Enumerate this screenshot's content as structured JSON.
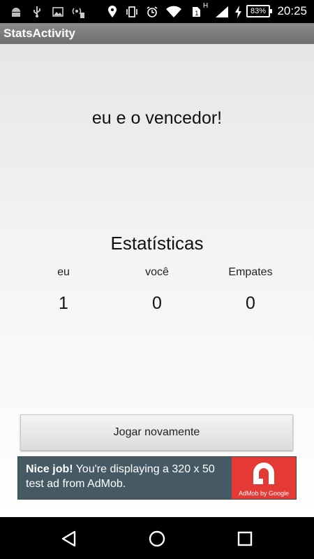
{
  "status_bar": {
    "time": "20:25",
    "battery": "83%",
    "network_label": "H",
    "icons": [
      "android-icon",
      "usb-icon",
      "image-icon",
      "hotspot-icon",
      "location-icon",
      "vibrate-icon",
      "alarm-icon",
      "wifi-icon",
      "sim-icon",
      "signal-icon",
      "charging-icon",
      "battery-icon"
    ]
  },
  "app_bar": {
    "title": "StatsActivity"
  },
  "main": {
    "result_text": "eu e o vencedor!",
    "stats_title": "Estatísticas",
    "stats": [
      {
        "label": "eu",
        "value": "1"
      },
      {
        "label": "você",
        "value": "0"
      },
      {
        "label": "Empates",
        "value": "0"
      }
    ],
    "play_again_label": "Jogar novamente"
  },
  "ad": {
    "headline": "Nice job!",
    "body": " You're displaying a 320 x 50 test ad from AdMob.",
    "logo_caption": "AdMob by Google",
    "background_color": "#455a64",
    "logo_color": "#e53935"
  },
  "nav_bar": {
    "buttons": [
      "back-icon",
      "home-icon",
      "recents-icon"
    ]
  }
}
